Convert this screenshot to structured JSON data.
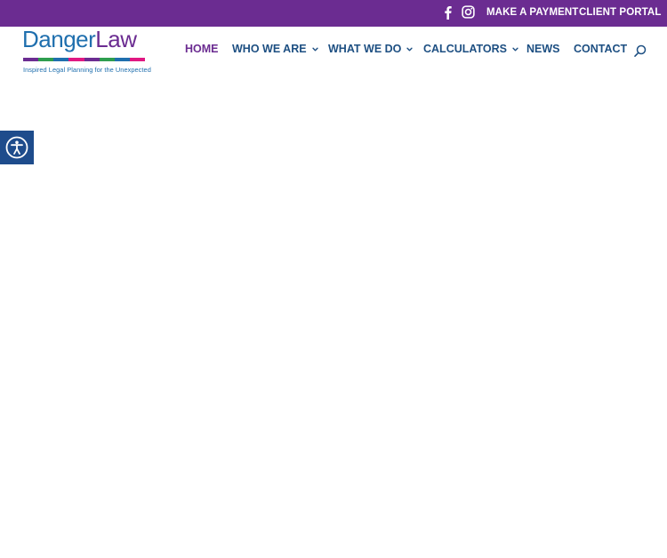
{
  "colors": {
    "topbar": "#6b2c91",
    "nav_text": "#1d4f82",
    "nav_active": "#6b2c91",
    "a11y": "#1e4c8c"
  },
  "topbar": {
    "social": [
      {
        "icon": "facebook-icon"
      },
      {
        "icon": "instagram-icon"
      }
    ],
    "links": {
      "payment": "MAKE A PAYMENT",
      "portal": "CLIENT PORTAL"
    }
  },
  "logo": {
    "word_part1": "Danger",
    "word_part2": "Law",
    "tagline": "Inspired Legal Planning for the Unexpected",
    "stripe_colors": [
      "#6b2c91",
      "#2e9d4f",
      "#1f6fae",
      "#e01882",
      "#6b2c91",
      "#2e9d4f",
      "#1f6fae",
      "#e01882"
    ]
  },
  "nav": {
    "items": [
      {
        "label": "HOME",
        "active": true,
        "dropdown": false
      },
      {
        "label": "WHO WE ARE",
        "active": false,
        "dropdown": true
      },
      {
        "label": "WHAT WE DO",
        "active": false,
        "dropdown": true
      },
      {
        "label": "CALCULATORS",
        "active": false,
        "dropdown": true
      },
      {
        "label": "NEWS",
        "active": false,
        "dropdown": false
      },
      {
        "label": "CONTACT",
        "active": false,
        "dropdown": false
      }
    ],
    "search_icon": "search-icon"
  },
  "accessibility": {
    "icon": "accessibility-icon"
  }
}
